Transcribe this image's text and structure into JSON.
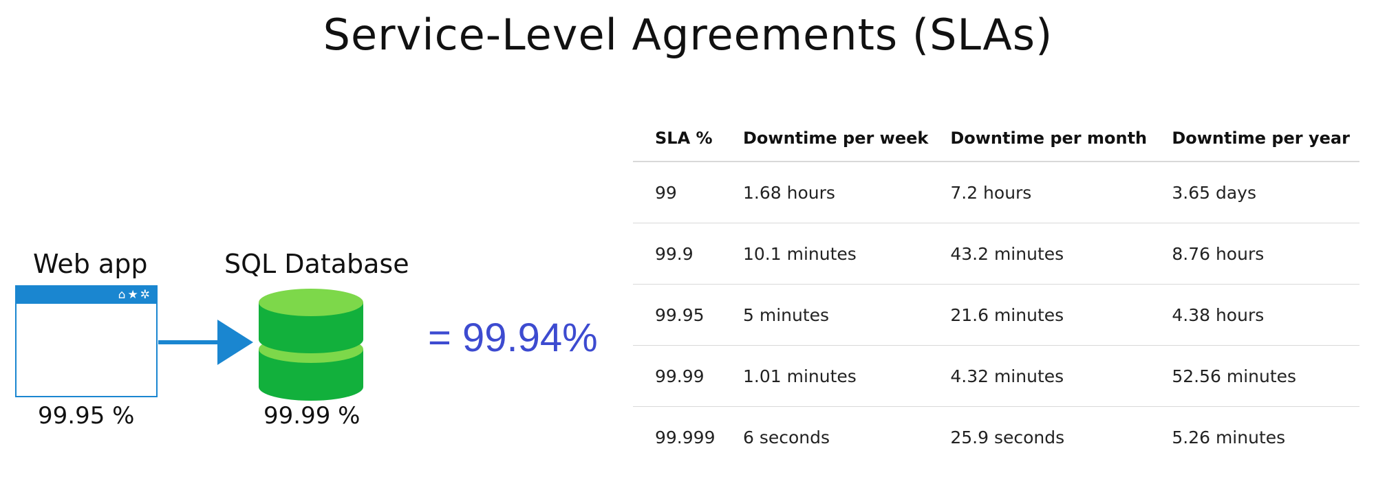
{
  "title": "Service-Level Agreements (SLAs)",
  "diagram": {
    "web_app": {
      "label": "Web app",
      "sla": "99.95 %",
      "titlebar_icons": "home-icon star-icon gear-icon",
      "color": "#1a86d0"
    },
    "database": {
      "label": "SQL Database",
      "sla": "99.99 %",
      "color": "#12b03c",
      "top_color": "#7dd84a"
    },
    "arrow_color": "#1a86d0",
    "result": "= 99.94%",
    "result_color": "#3d4bd0"
  },
  "table": {
    "headers": [
      "SLA %",
      "Downtime per week",
      "Downtime per month",
      "Downtime per year"
    ],
    "rows": [
      [
        "99",
        "1.68 hours",
        "7.2 hours",
        "3.65 days"
      ],
      [
        "99.9",
        "10.1 minutes",
        "43.2 minutes",
        "8.76 hours"
      ],
      [
        "99.95",
        "5 minutes",
        "21.6 minutes",
        "4.38 hours"
      ],
      [
        "99.99",
        "1.01 minutes",
        "4.32 minutes",
        "52.56 minutes"
      ],
      [
        "99.999",
        "6 seconds",
        "25.9 seconds",
        "5.26 minutes"
      ]
    ]
  }
}
